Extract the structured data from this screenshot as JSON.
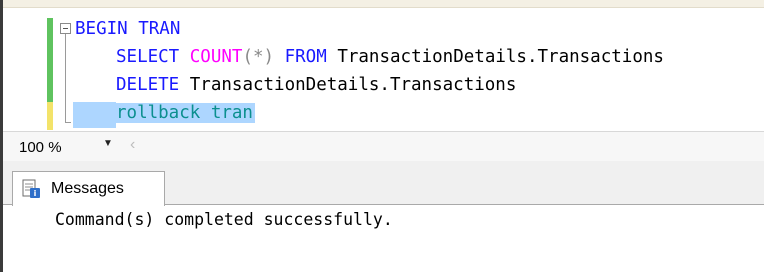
{
  "editor": {
    "line1": {
      "keyword": "BEGIN TRAN"
    },
    "line2": {
      "select": "SELECT",
      "count": "COUNT",
      "args": "(*)",
      "from": "FROM",
      "object": "TransactionDetails.Transactions"
    },
    "line3": {
      "delete": "DELETE",
      "object": "TransactionDetails.Transactions"
    },
    "line4": {
      "text": "rollback tran"
    }
  },
  "zoom": {
    "value": "100 %",
    "arrow_icon": "dropdown-arrow-icon",
    "scroll_icon": "scroll-left-icon"
  },
  "results": {
    "tab_label": "Messages",
    "tab_icon": "messages-icon",
    "message": "Command(s) completed successfully."
  },
  "colors": {
    "keyword": "#1a1aff",
    "function": "#ff00ff",
    "operator": "#8a8a8a",
    "selection": "#add6ff",
    "changed_saved": "#5fc35f",
    "changed_unsaved": "#f3e36a"
  }
}
